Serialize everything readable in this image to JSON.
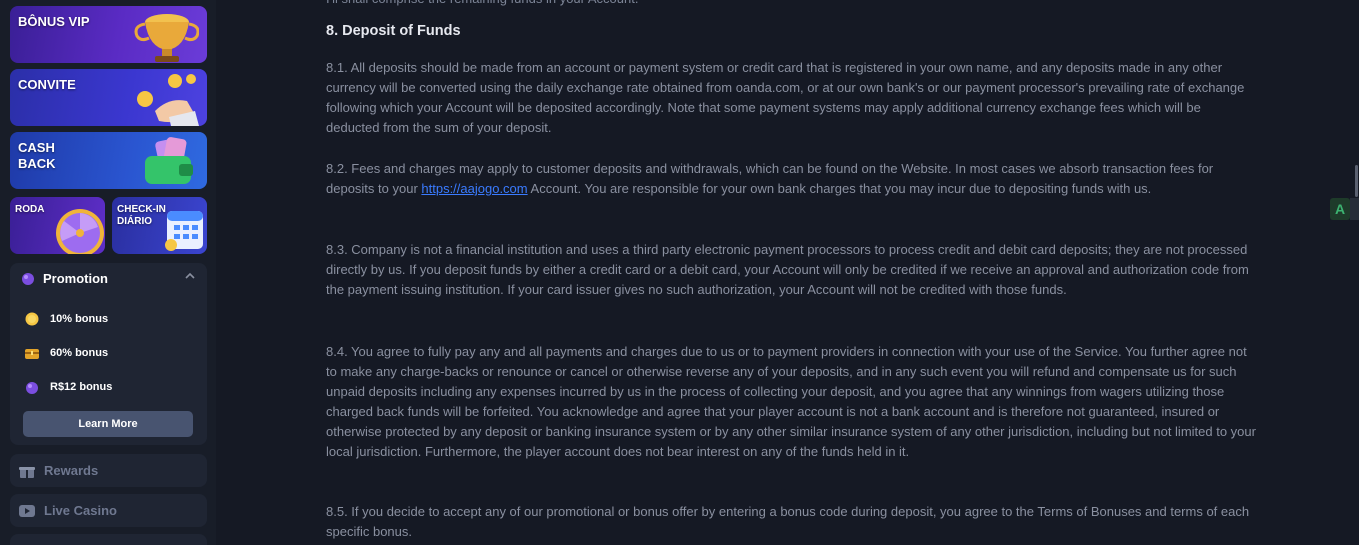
{
  "sidebar": {
    "banners": {
      "vip": "BÔNUS VIP",
      "convite": "CONVITE",
      "cash_line1": "CASH",
      "cash_line2": "BACK",
      "roda": "RODA",
      "check_line1": "CHECK-IN",
      "check_line2": "DIÁRIO"
    },
    "promotion": {
      "title": "Promotion",
      "items": [
        {
          "label": "10% bonus",
          "icon": "coin-icon"
        },
        {
          "label": "60% bonus",
          "icon": "treasure-chest-icon"
        },
        {
          "label": "R$12 bonus",
          "icon": "gem-bag-icon"
        }
      ],
      "learn_more": "Learn More"
    },
    "nav": [
      {
        "label": "Rewards",
        "icon": "gift-icon"
      },
      {
        "label": "Live Casino",
        "icon": "play-icon"
      }
    ]
  },
  "document": {
    "previous_line": "I'll shall comprise the remaining funds in your Account.",
    "heading": "8. Deposit of Funds",
    "p1": "8.1. All deposits should be made from an account or payment system or credit card that is registered in your own name, and any deposits made in any other currency will be converted using the daily exchange rate obtained from oanda.com, or at our own bank's or our payment processor's prevailing rate of exchange following which your Account will be deposited accordingly. Note that some payment systems may apply additional currency exchange fees which will be deducted from the sum of your deposit.",
    "p2_before": "8.2. Fees and charges may apply to customer deposits and withdrawals, which can be found on the Website. In most cases we absorb transaction fees for deposits to your ",
    "p2_link": "https://aajogo.com",
    "p2_after": " Account. You are responsible for your own bank charges that you may incur due to depositing funds with us.",
    "p3": "8.3. Company is not a financial institution and uses a third party electronic payment processors to process credit and debit card deposits; they are not processed directly by us. If you deposit funds by either a credit card or a debit card, your Account will only be credited if we receive an approval and authorization code from the payment issuing institution. If your card issuer gives no such authorization, your Account will not be credited with those funds.",
    "p4": "8.4. You agree to fully pay any and all payments and charges due to us or to payment providers in connection with your use of the Service. You further agree not to make any charge-backs or renounce or cancel or otherwise reverse any of your deposits, and in any such event you will refund and compensate us for such unpaid deposits including any expenses incurred by us in the process of collecting your deposit, and you agree that any winnings from wagers utilizing those charged back funds will be forfeited. You acknowledge and agree that your player account is not a bank account and is therefore not guaranteed, insured or otherwise protected by any deposit or banking insurance system or by any other similar insurance system of any other jurisdiction, including but not limited to your local jurisdiction. Furthermore, the player account does not bear interest on any of the funds held in it.",
    "p5": "8.5. If you decide to accept any of our promotional or bonus offer by entering a bonus code during deposit, you agree to the Terms of Bonuses and terms of each specific bonus."
  },
  "floating": {
    "badge": "A"
  },
  "colors": {
    "background": "#151924",
    "sidebar": "#181d28",
    "panel": "#1f2533",
    "link": "#3a7bff",
    "text": "#8a90a0"
  }
}
